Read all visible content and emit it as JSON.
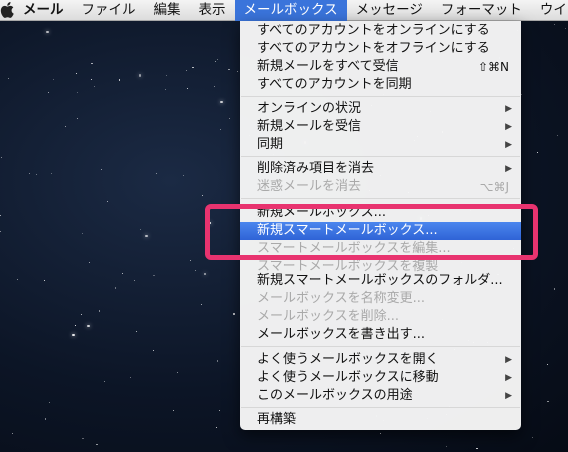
{
  "menubar": {
    "items": [
      "メール",
      "ファイル",
      "編集",
      "表示",
      "メールボックス",
      "メッセージ",
      "フォーマット",
      "ウインド"
    ]
  },
  "menu": {
    "items": [
      {
        "label": "すべてのアカウントをオンラインにする",
        "disabled": true
      },
      {
        "label": "すべてのアカウントをオフラインにする"
      },
      {
        "label": "新規メールをすべて受信",
        "shortcut": "⇧⌘N"
      },
      {
        "label": "すべてのアカウントを同期"
      },
      {
        "label": "オンラインの状況",
        "submenu": true
      },
      {
        "label": "新規メールを受信",
        "submenu": true
      },
      {
        "label": "同期",
        "submenu": true
      },
      {
        "label": "削除済み項目を消去",
        "submenu": true
      },
      {
        "label": "迷惑メールを消去",
        "disabled": true,
        "shortcut": "⌥⌘J"
      },
      {
        "label": "新規メールボックス..."
      },
      {
        "label": "新規スマートメールボックス...",
        "highlighted": true
      },
      {
        "label": "スマートメールボックスを編集...",
        "disabled": true
      },
      {
        "label": "スマートメールボックスを複製",
        "disabled": true
      },
      {
        "label": "新規スマートメールボックスのフォルダ..."
      },
      {
        "label": "メールボックスを名称変更...",
        "disabled": true
      },
      {
        "label": "メールボックスを削除...",
        "disabled": true
      },
      {
        "label": "メールボックスを書き出す..."
      },
      {
        "label": "よく使うメールボックスを開く",
        "submenu": true
      },
      {
        "label": "よく使うメールボックスに移動",
        "submenu": true
      },
      {
        "label": "このメールボックスの用途",
        "submenu": true
      },
      {
        "label": "再構築"
      }
    ],
    "submenu_arrow": "▶"
  },
  "colors": {
    "menu_highlight": "#3a74db",
    "annotation": "#e8336f"
  }
}
